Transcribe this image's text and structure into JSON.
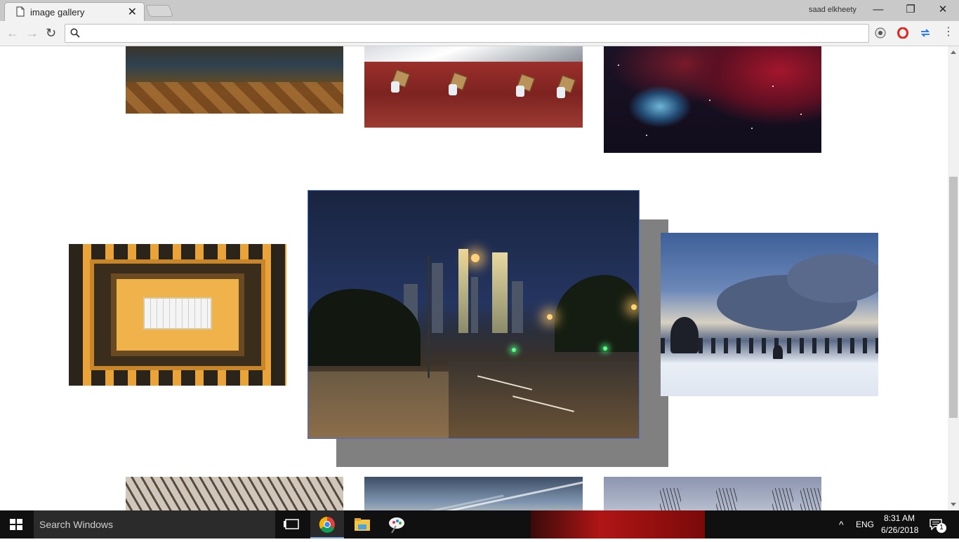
{
  "browser": {
    "tab_title": "image gallery",
    "tab_close": "✕",
    "user_name": "saad elkheety",
    "window_controls": {
      "minimize": "—",
      "restore": "❐",
      "close": "✕"
    },
    "nav": {
      "back": "←",
      "forward": "→",
      "reload": "↻"
    },
    "address_value": "",
    "menu": "⋮",
    "extensions": [
      "reader-icon",
      "opera-icon",
      "sync-icon"
    ]
  },
  "gallery": {
    "selected_photo": "city-night",
    "photos": [
      "palace-interior",
      "porters-red-rock",
      "nebula",
      "ceiling-skylight",
      "city-night",
      "snowy-field",
      "bare-branches",
      "contrail-sky",
      "winter-trees"
    ]
  },
  "taskbar": {
    "search_placeholder": "Search Windows",
    "language": "ENG",
    "time": "8:31 AM",
    "date": "6/26/2018",
    "notification_count": "1",
    "tray_chevron": "^",
    "pinned_apps": [
      "task-view-icon",
      "chrome-icon",
      "file-explorer-icon",
      "paint-icon"
    ]
  },
  "colors": {
    "selection_border": "#4a6fd6",
    "shadow_box": "#808080",
    "taskbar": "#101010"
  }
}
